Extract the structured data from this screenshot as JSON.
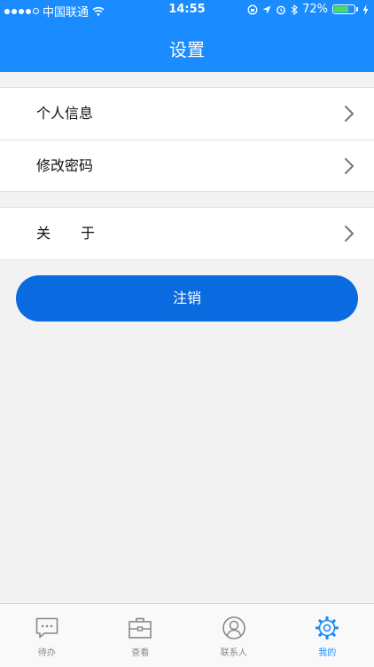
{
  "status_bar": {
    "carrier": "中国联通",
    "time": "14:55",
    "battery": "72%",
    "battery_level": 0.72
  },
  "header": {
    "title": "设置"
  },
  "settings": {
    "group1": [
      {
        "label": "个人信息"
      },
      {
        "label": "修改密码"
      }
    ],
    "group2": [
      {
        "label": "关于"
      }
    ]
  },
  "logout_button": {
    "label": "注销"
  },
  "tabbar": {
    "tabs": [
      {
        "label": "待办",
        "icon": "message-icon"
      },
      {
        "label": "查看",
        "icon": "briefcase-icon"
      },
      {
        "label": "联系人",
        "icon": "contact-icon"
      },
      {
        "label": "我的",
        "icon": "gear-icon"
      }
    ],
    "active_index": 3
  },
  "colors": {
    "accent": "#1a8cff",
    "button": "#0a6ae0",
    "battery": "#4cd964"
  }
}
